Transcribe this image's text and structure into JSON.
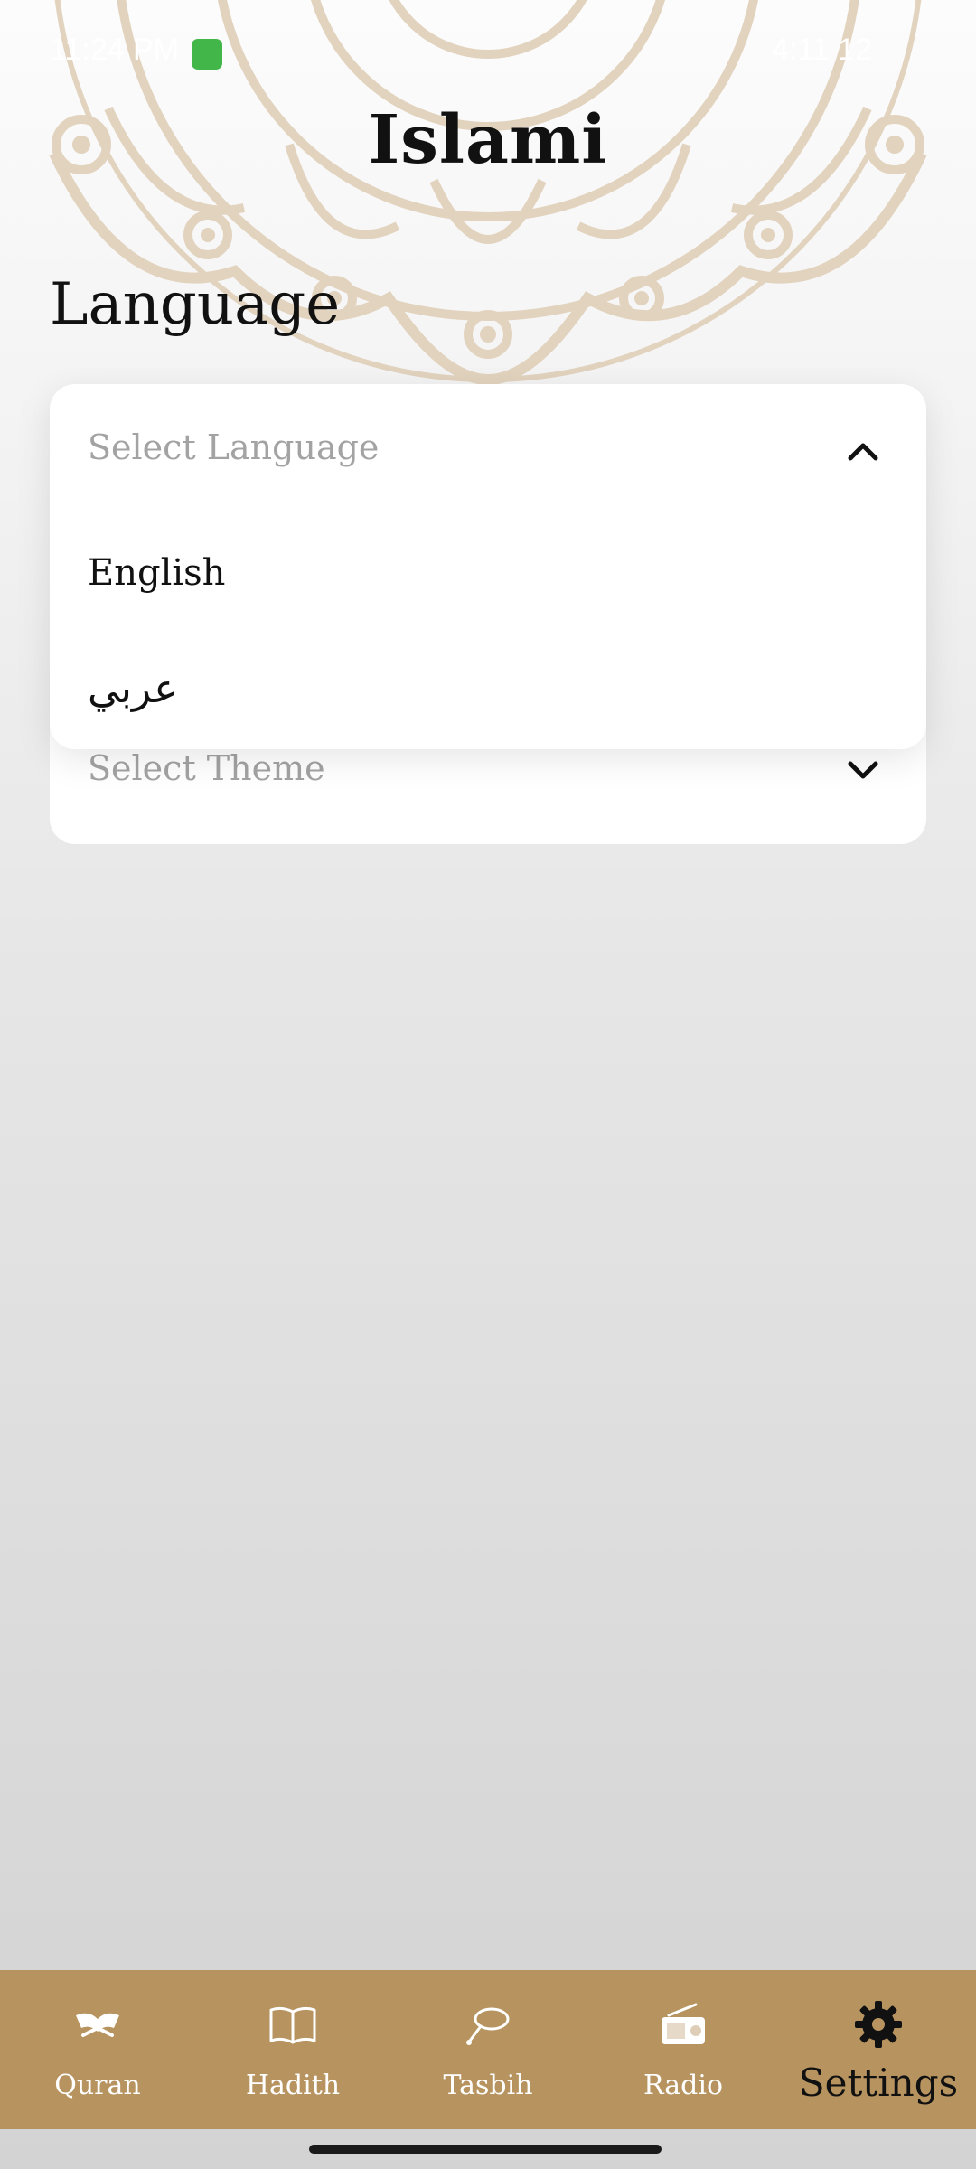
{
  "status_bar": {
    "time": "11:24 PM",
    "right": "4:11 12"
  },
  "app": {
    "title": "Islami"
  },
  "settings": {
    "section_title": "Language",
    "language_select": {
      "placeholder": "Select Language",
      "options": [
        "English",
        "عربي"
      ]
    },
    "theme_select": {
      "placeholder": "Select Theme"
    }
  },
  "nav": {
    "items": [
      {
        "label": "Quran",
        "icon": "quran-icon"
      },
      {
        "label": "Hadith",
        "icon": "book-icon"
      },
      {
        "label": "Tasbih",
        "icon": "tasbih-icon"
      },
      {
        "label": "Radio",
        "icon": "radio-icon"
      },
      {
        "label": "Settings",
        "icon": "gear-icon"
      }
    ],
    "active": "Settings"
  },
  "colors": {
    "nav_bg": "#b7935f",
    "mandala": "#e2d3be",
    "status_app_icon": "#43b649"
  }
}
